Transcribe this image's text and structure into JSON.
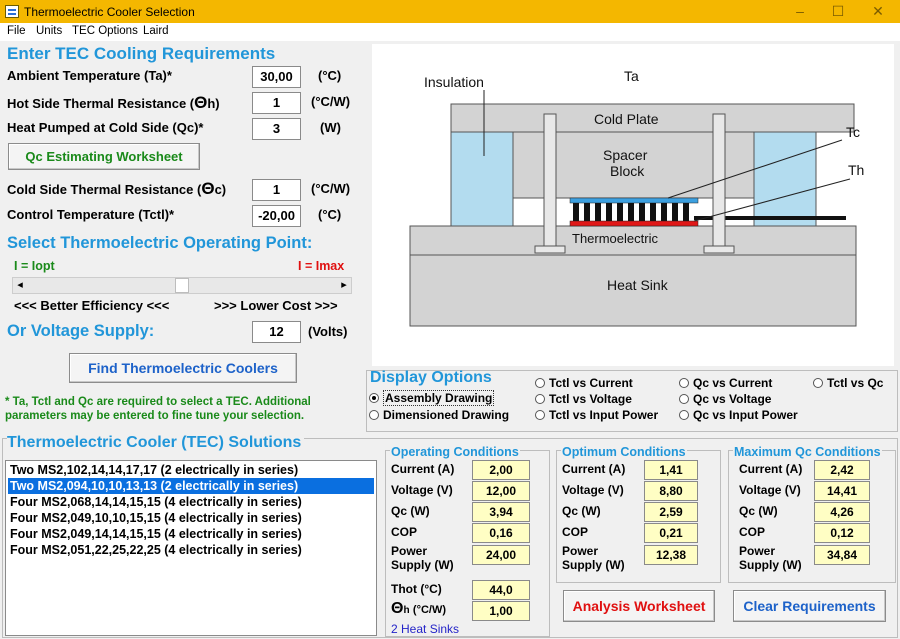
{
  "window": {
    "title": "Thermoelectric Cooler Selection",
    "min": "–",
    "max": "☐",
    "close": "✕"
  },
  "menu": [
    "File",
    "Units",
    "TEC Options",
    "Laird"
  ],
  "requirements": {
    "heading": "Enter TEC Cooling Requirements",
    "ambient": {
      "label": "Ambient Temperature (Ta)*",
      "value": "30,00",
      "unit": "(°C)"
    },
    "hot_res": {
      "label": "Hot Side Thermal Resistance (",
      "theta": "Θ",
      "sub": "h)",
      "value": "1",
      "unit": "(°C/W)"
    },
    "qc": {
      "label": "Heat Pumped at Cold Side (Qc)*",
      "value": "3",
      "unit": "(W)"
    },
    "worksheet_btn": "Qc Estimating Worksheet",
    "cold_res": {
      "label": "Cold Side Thermal Resistance (",
      "theta": "Θ",
      "sub": "c)",
      "value": "1",
      "unit": "(°C/W)"
    },
    "control": {
      "label": "Control Temperature (Tctl)*",
      "value": "-20,00",
      "unit": "(°C)"
    }
  },
  "operating_point": {
    "heading": "Select Thermoelectric Operating Point:",
    "left_label": "I = Iopt",
    "right_label": "I = Imax",
    "slider_pos": 0.5,
    "scroll_left": "◂",
    "scroll_right": "▸",
    "efficiency": "<<< Better Efficiency <<<",
    "cost": ">>> Lower Cost >>>"
  },
  "voltage": {
    "label": "Or Voltage Supply:",
    "value": "12",
    "unit": "(Volts)"
  },
  "find_btn": "Find Thermoelectric Coolers",
  "footnote": "* Ta, Tctl and Qc are required to select a TEC. Additional parameters may be entered to fine tune your selection.",
  "diagram": {
    "insulation": "Insulation",
    "ta": "Ta",
    "cold_plate": "Cold Plate",
    "spacer": "Spacer",
    "block": "Block",
    "tc": "Tc",
    "th": "Th",
    "thermoelectric": "Thermoelectric",
    "heat_sink": "Heat Sink"
  },
  "display_options": {
    "heading": "Display Options",
    "options": [
      {
        "label": "Assembly Drawing",
        "selected": true
      },
      {
        "label": "Dimensioned Drawing",
        "selected": false
      },
      {
        "label": "Tctl vs Current",
        "selected": false
      },
      {
        "label": "Tctl vs Voltage",
        "selected": false
      },
      {
        "label": "Tctl vs Input Power",
        "selected": false
      },
      {
        "label": "Qc vs Current",
        "selected": false
      },
      {
        "label": "Qc vs Voltage",
        "selected": false
      },
      {
        "label": "Qc vs Input Power",
        "selected": false
      },
      {
        "label": "Tctl vs Qc",
        "selected": false
      }
    ]
  },
  "solutions": {
    "heading": "Thermoelectric Cooler (TEC) Solutions",
    "items": [
      "Two MS2,102,14,14,17,17 (2 electrically in series)",
      "Two MS2,094,10,10,13,13 (2 electrically in series)",
      "Four MS2,068,14,14,15,15 (4 electrically in series)",
      "Four MS2,049,10,10,15,15 (4 electrically in series)",
      "Four MS2,049,14,14,15,15 (4 electrically in series)",
      "Four MS2,051,22,25,22,25 (4 electrically in series)"
    ],
    "selected_index": 1
  },
  "labels": {
    "current": "Current (A)",
    "voltage": "Voltage (V)",
    "qc": "Qc (W)",
    "cop": "COP",
    "power1": "Power",
    "power2": "Supply (W)"
  },
  "operating": {
    "heading": "Operating Conditions",
    "current": "2,00",
    "voltage": "12,00",
    "qc": "3,94",
    "cop": "0,16",
    "power": "24,00",
    "thot_label": "Thot (°C)",
    "thot": "44,0",
    "theta_label": "Θ",
    "theta_sub": "h",
    "theta_unit": "(°C/W)",
    "theta": "1,00",
    "heat_sinks": "2 Heat Sinks"
  },
  "optimum": {
    "heading": "Optimum Conditions",
    "current": "1,41",
    "voltage": "8,80",
    "qc": "2,59",
    "cop": "0,21",
    "power": "12,38"
  },
  "maximum": {
    "heading": "Maximum Qc Conditions",
    "current": "2,42",
    "voltage": "14,41",
    "qc": "4,26",
    "cop": "0,12",
    "power": "34,84"
  },
  "analysis_btn": "Analysis Worksheet",
  "clear_btn": "Clear Requirements",
  "colors": {
    "title_bar": "#f4b700",
    "heading_blue": "#2196d9",
    "green": "#1a8a1a",
    "red": "#e01010",
    "value_yellow": "#fffec4",
    "selection": "#0a6fe0"
  }
}
